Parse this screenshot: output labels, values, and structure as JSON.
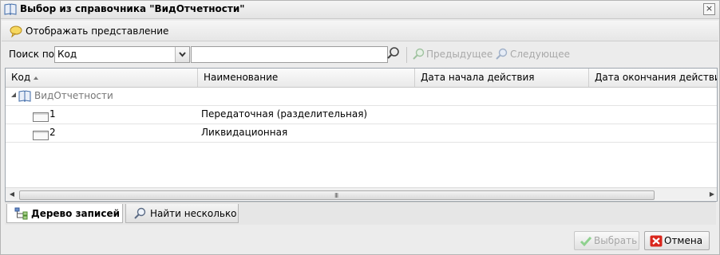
{
  "window": {
    "title": "Выбор из справочника \"ВидОтчетности\"",
    "close_label": "×"
  },
  "toolbar": {
    "show_view_label": "Отображать представление"
  },
  "search": {
    "label": "Поиск по",
    "field_value": "Код",
    "query_value": "",
    "prev_label": "Предыдущее",
    "next_label": "Следующее"
  },
  "grid": {
    "columns": [
      "Код",
      "Наименование",
      "Дата начала действия",
      "Дата окончания действия"
    ],
    "sorted_column": "Код",
    "sort_direction": "asc",
    "root": {
      "label": "ВидОтчетности",
      "icon": "book-icon"
    },
    "rows": [
      {
        "code": "1",
        "name": "Передаточная (разделительная)",
        "start": "",
        "end": ""
      },
      {
        "code": "2",
        "name": "Ликвидационная",
        "start": "",
        "end": ""
      }
    ],
    "scroll_grip": "III"
  },
  "tabs": [
    {
      "label": "Дерево записей",
      "icon": "tree-icon",
      "active": true
    },
    {
      "label": "Найти несколько",
      "icon": "search-icon",
      "active": false
    }
  ],
  "buttons": {
    "select_label": "Выбрать",
    "select_enabled": false,
    "cancel_label": "Отмена"
  },
  "colors": {
    "cancel_icon": "#d9261c",
    "check_icon": "#8fd18f"
  }
}
